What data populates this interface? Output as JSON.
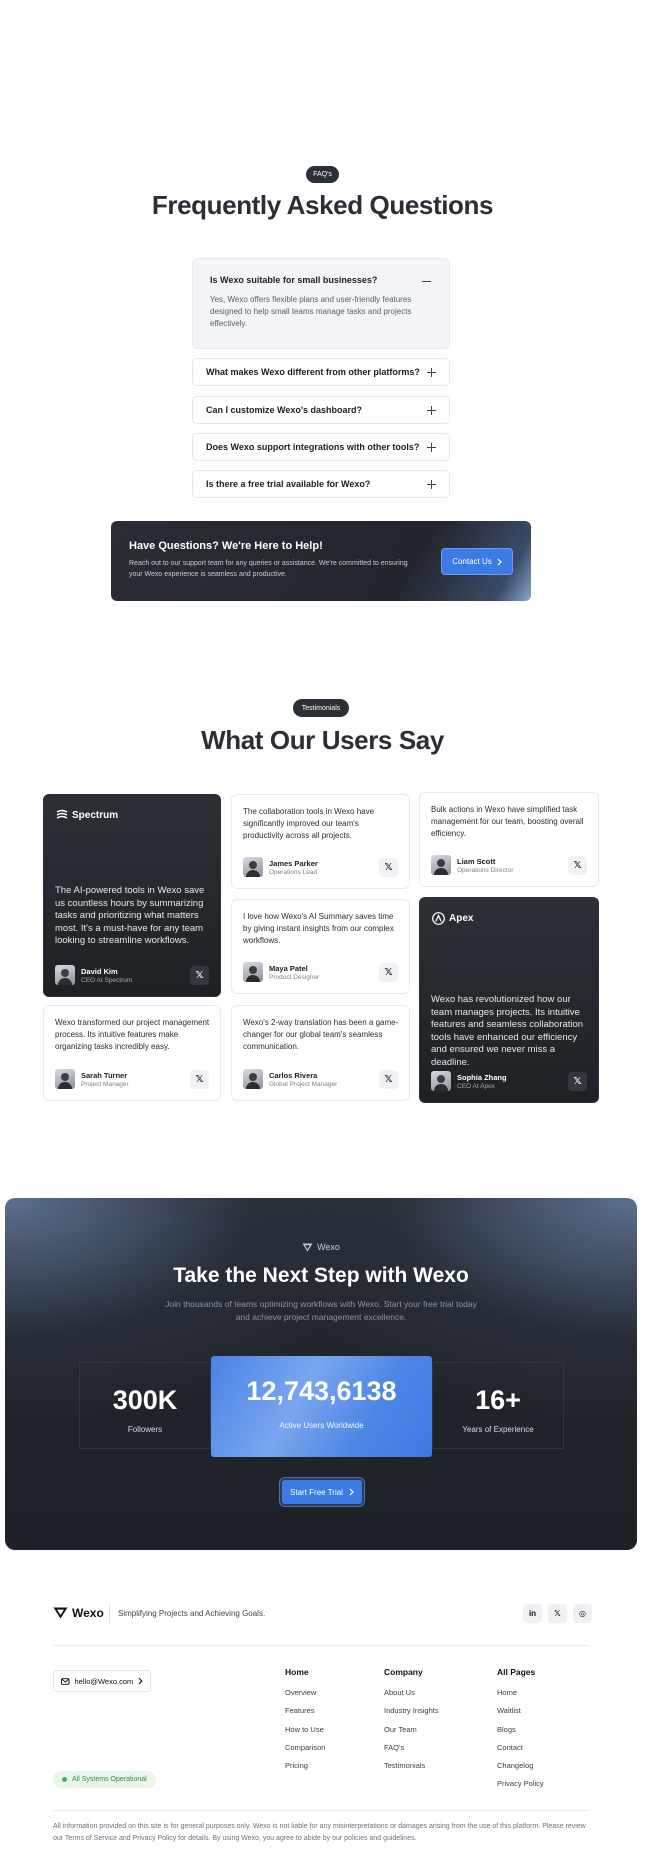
{
  "faq": {
    "badge": "FAQ's",
    "title": "Frequently Asked Questions",
    "open_item": {
      "question": "Is Wexo suitable for small businesses?",
      "answer": "Yes, Wexo offers flexible plans and user-friendly features designed to help small teams manage tasks and projects effectively."
    },
    "items": [
      "What makes Wexo different from other platforms?",
      "Can I customize Wexo's dashboard?",
      "Does Wexo support integrations with other tools?",
      "Is there a free trial available for Wexo?"
    ],
    "help": {
      "title": "Have Questions? We're Here to Help!",
      "subtitle": "Reach out to our support team for any queries or assistance. We're committed to ensuring your Wexo experience is seamless and productive.",
      "button": "Contact Us"
    }
  },
  "testimonials": {
    "badge": "Testimonials",
    "title": "What Our Users Say",
    "cards": [
      {
        "brand": "Spectrum",
        "quote": "The AI-powered tools in Wexo save us countless hours by summarizing tasks and prioritizing what matters most. It's a must-have for any team looking to streamline workflows.",
        "name": "David Kim",
        "role": "CEO At Spectrum"
      },
      {
        "quote": "The collaboration tools in Wexo have significantly improved our team's productivity across all projects.",
        "name": "James Parker",
        "role": "Operations Lead"
      },
      {
        "quote": "Bulk actions in Wexo have simplified task management for our team, boosting overall efficiency.",
        "name": "Liam Scott",
        "role": "Operations Director"
      },
      {
        "quote": "I love how Wexo's AI Summary saves time by giving instant insights from our complex workflows.",
        "name": "Maya Patel",
        "role": "Product Designer"
      },
      {
        "brand": "Apex",
        "quote": "Wexo has revolutionized how our team manages projects. Its intuitive features and seamless collaboration tools have enhanced our efficiency and ensured we never miss a deadline.",
        "name": "Sophia Zhang",
        "role": "CEO At Apex"
      },
      {
        "quote": "Wexo transformed our project management process. Its intuitive features make organizing tasks incredibly easy.",
        "name": "Sarah Turner",
        "role": "Project Manager"
      },
      {
        "quote": "Wexo's 2-way translation has been a game-changer for our global team's seamless communication.",
        "name": "Carlos Rivera",
        "role": "Global Project Manager"
      }
    ],
    "x_glyph": "𝕏"
  },
  "cta": {
    "logo": "Wexo",
    "title": "Take the Next Step with Wexo",
    "subtitle": "Join thousands of teams optimizing workflows with Wexo. Start your free trial today and achieve project management excellence.",
    "stats": [
      {
        "value": "300K",
        "label": "Followers"
      },
      {
        "value": "12,743,6138",
        "label": "Active Users Worldwide"
      },
      {
        "value": "16+",
        "label": "Years of Experience"
      }
    ],
    "button": "Start Free Trial"
  },
  "footer": {
    "logo": "Wexo",
    "tagline": "Simplifying Projects and Achieving Goals.",
    "socials": [
      "in",
      "𝕏",
      "◎"
    ],
    "email": "hello@Wexo.com",
    "columns": [
      {
        "heading": "Home",
        "links": [
          "Overview",
          "Features",
          "How to Use",
          "Comparison",
          "Pricing"
        ]
      },
      {
        "heading": "Company",
        "links": [
          "About Us",
          "Industry Insights",
          "Our Team",
          "FAQ's",
          "Testimonials"
        ]
      },
      {
        "heading": "All Pages",
        "links": [
          "Home",
          "Waitlist",
          "Blogs",
          "Contact",
          "Changelog",
          "Privacy Policy"
        ]
      }
    ],
    "status": "All Systems Operational",
    "legal": "All information provided on this site is for general purposes only. Wexo is not liable for any misinterpretations or damages arising from the use of this platform. Please review our Terms of Service and Privacy Policy for details. By using Wexo, you agree to abide by our policies and guidelines."
  },
  "colors": {
    "accent": "#3b7be3",
    "dark": "#22252b",
    "status_green": "#2e8a45"
  }
}
